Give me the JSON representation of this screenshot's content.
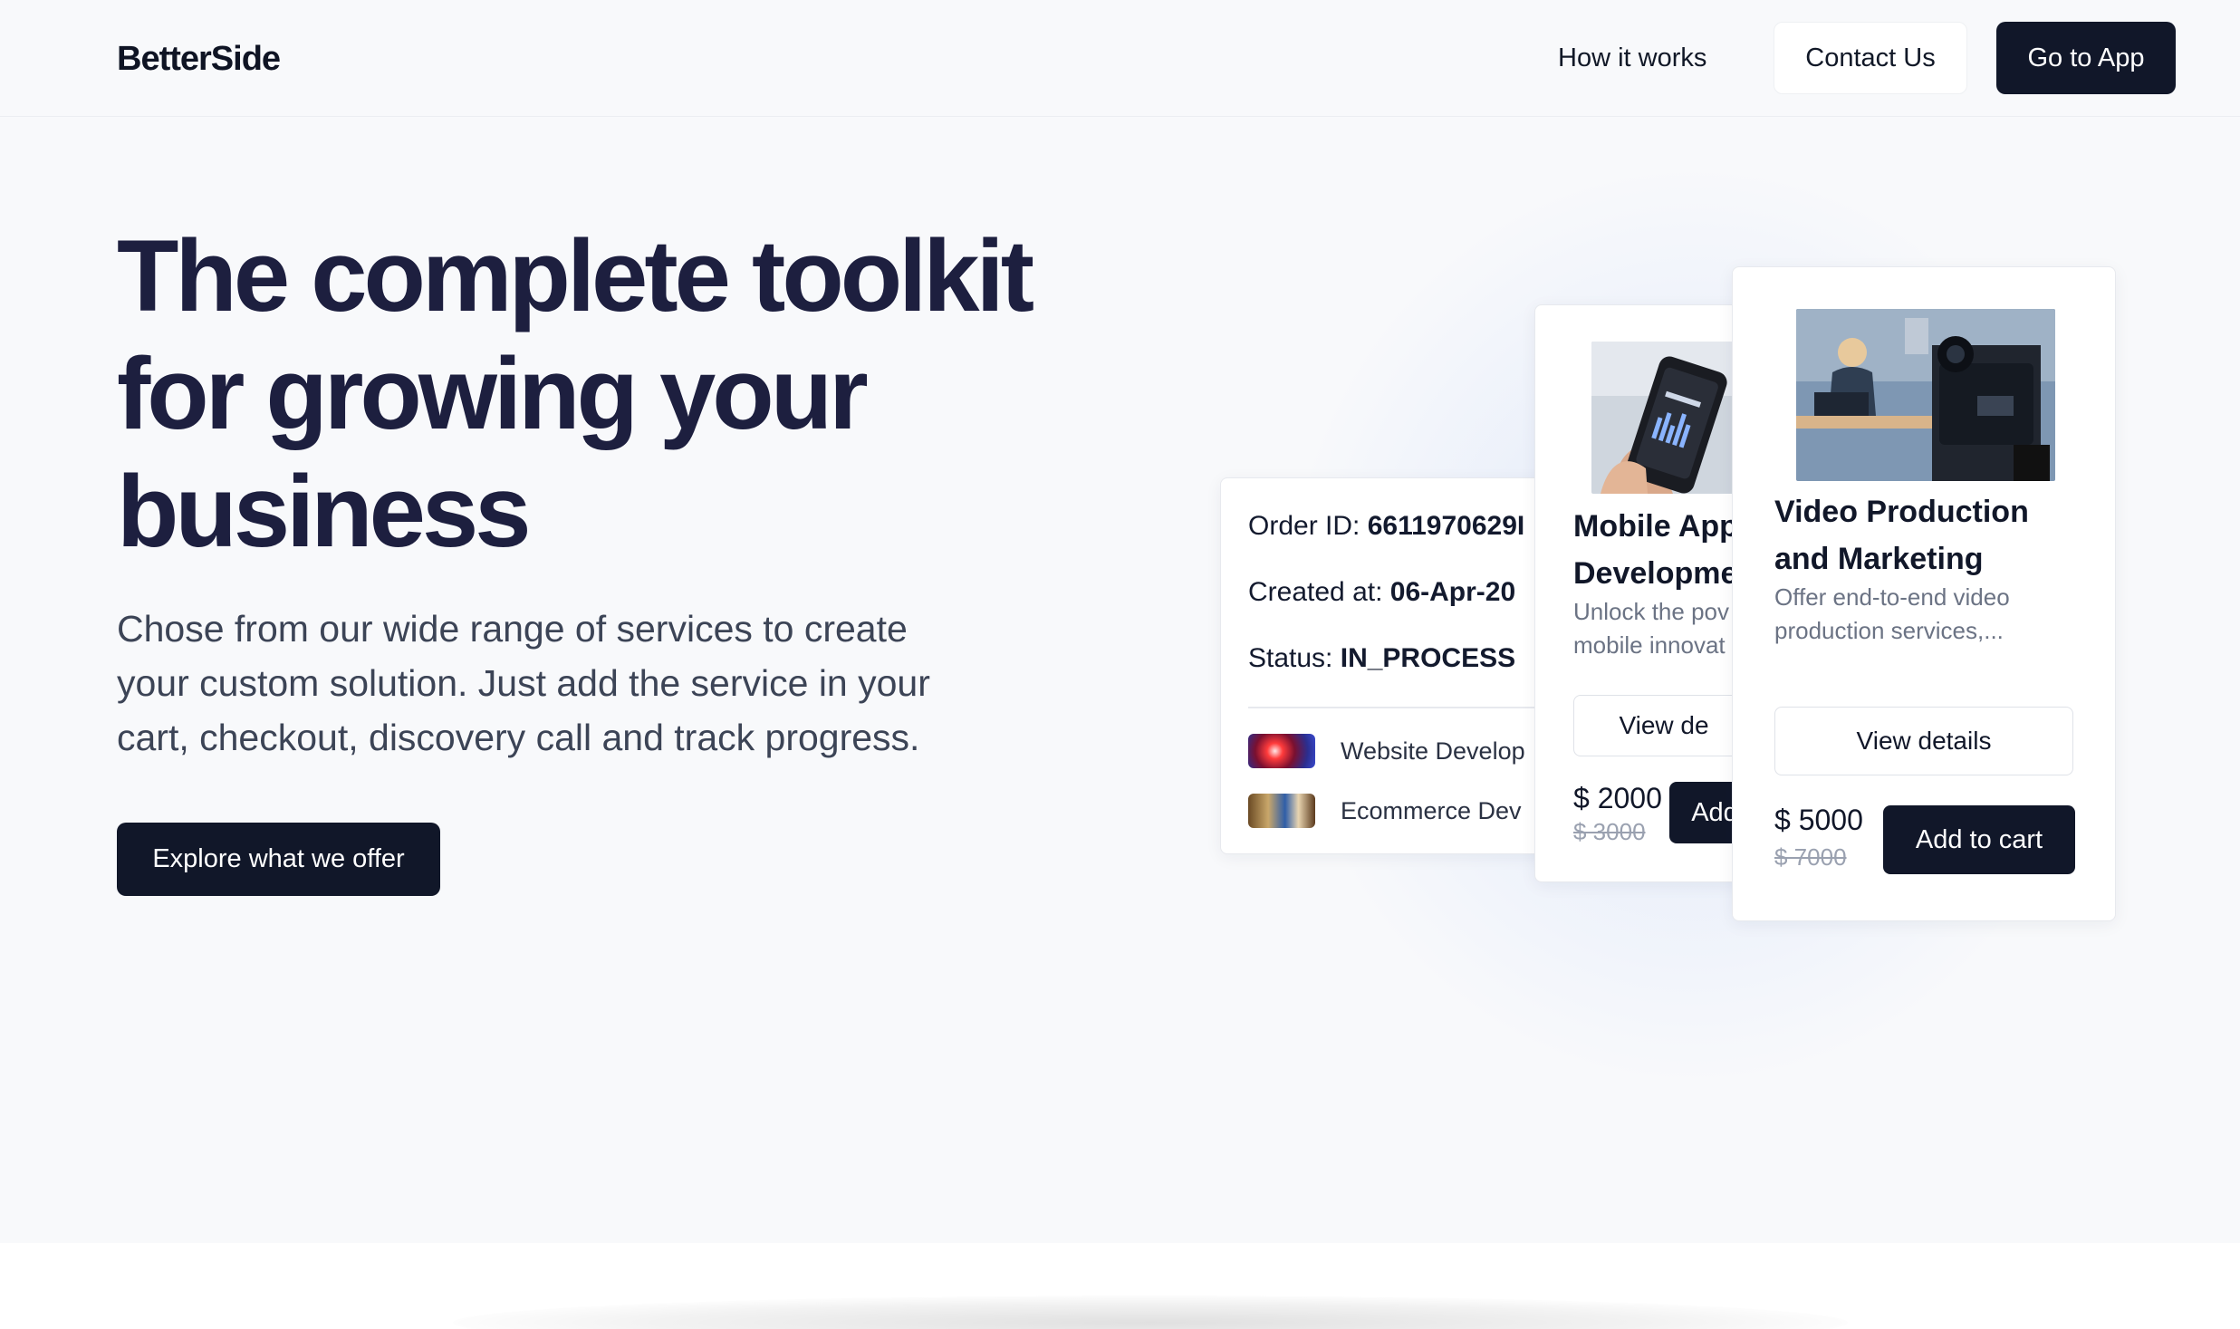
{
  "header": {
    "logo": "BetterSide",
    "nav_how": "How it works",
    "contact_label": "Contact Us",
    "app_label": "Go to App"
  },
  "hero": {
    "title_line1": "The complete toolkit",
    "title_line2": "for growing your",
    "title_line3": "business",
    "subtitle_line1": "Chose from our wide range of services to create",
    "subtitle_line2": "your custom solution. Just add the service in your",
    "subtitle_line3": "cart, checkout, discovery call and track progress.",
    "cta_label": "Explore what we offer"
  },
  "order_card": {
    "order_id_label": "Order ID:",
    "order_id_value": "6611970629I",
    "created_label": "Created at:",
    "created_value": "06-Apr-20",
    "status_label": "Status:",
    "status_value": "IN_PROCESS",
    "items": [
      {
        "label": "Website Develop",
        "thumb": "website-thumbnail"
      },
      {
        "label": "Ecommerce Dev",
        "thumb": "ecommerce-thumbnail"
      }
    ]
  },
  "mobile_card": {
    "title_line1": "Mobile App",
    "title_line2": "Developme",
    "desc_line1": "Unlock the pov",
    "desc_line2": "mobile innovat",
    "view_label": "View de",
    "price": "$ 2000",
    "old_price": "$ 3000",
    "add_label": "Add"
  },
  "video_card": {
    "title_line1": "Video Production",
    "title_line2": "and Marketing",
    "desc_line1": "Offer end-to-end video",
    "desc_line2": "production services,...",
    "view_label": "View details",
    "price": "$ 5000",
    "old_price": "$ 7000",
    "add_label": "Add to cart"
  },
  "colors": {
    "primary": "#111729",
    "heading": "#1d1f3f",
    "background": "#f8f9fb"
  }
}
